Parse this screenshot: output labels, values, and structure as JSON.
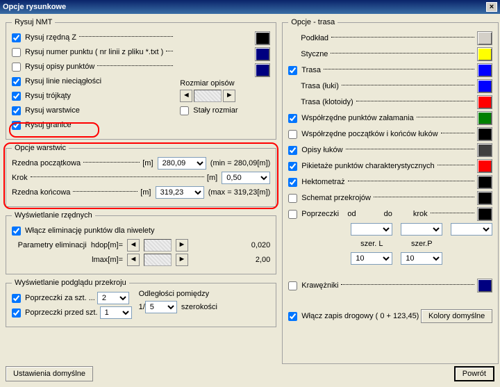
{
  "title": "Opcje rysunkowe",
  "nmt": {
    "legend": "Rysuj NMT",
    "rzedna_z": {
      "label": "Rysuj rzędną Z",
      "checked": true,
      "color": "#000000"
    },
    "numer_pkt": {
      "label": "Rysuj numer punktu ( nr linii z pliku *.txt )",
      "checked": false,
      "color": "#000080"
    },
    "opisy_pkt": {
      "label": "Rysuj opisy punktów",
      "checked": false,
      "color": "#000080"
    },
    "linie_nieciag": {
      "label": "Rysuj linie nieciągłości",
      "checked": true
    },
    "trojkaty": {
      "label": "Rysuj trójkąty",
      "checked": true
    },
    "warstwice": {
      "label": "Rysuj warstwice",
      "checked": true
    },
    "granice": {
      "label": "Rysuj granice",
      "checked": true
    },
    "rozmiar_opisow": "Rozmiar opisów",
    "staly_rozmiar": {
      "label": "Stały rozmiar",
      "checked": false
    }
  },
  "warstwice": {
    "legend": "Opcje warstwic",
    "rzedna_pocz": {
      "label": "Rzedna początkowa",
      "unit": "[m]",
      "value": "280,09",
      "hint": "(min = 280,09[m])"
    },
    "krok": {
      "label": "Krok",
      "unit": "[m]",
      "value": "0,50"
    },
    "rzedna_konc": {
      "label": "Rzedna końcowa",
      "unit": "[m]",
      "value": "319,23",
      "hint": "(max = 319,23[m])"
    }
  },
  "rzednych": {
    "legend": "Wyświetlanie rzędnych",
    "wlacz": {
      "label": "Włącz eliminację punktów dla niwelety",
      "checked": true
    },
    "params_label": "Parametry eliminacji",
    "hdop": {
      "label": "hdop[m]=",
      "value": "0,020"
    },
    "lmax": {
      "label": "lmax[m]=",
      "value": "2,00"
    }
  },
  "przekroj": {
    "legend": "Wyświetlanie podglądu przekroju",
    "za": {
      "label": "Poprzeczki za szt.",
      "value": "2",
      "checked": true
    },
    "przed": {
      "label": "Poprzeczki przed szt.",
      "value": "1",
      "checked": true
    },
    "odl": "Odległości pomiędzy",
    "frac_prefix": "1/",
    "frac_value": "5",
    "frac_suffix": "szerokości"
  },
  "trasa": {
    "legend": "Opcje - trasa",
    "podklad": {
      "label": "Podkład",
      "checked": false,
      "color": "#D4D0C8"
    },
    "styczne": {
      "label": "Styczne",
      "checked": false,
      "color": "#FFFF00"
    },
    "trasa": {
      "label": "Trasa",
      "checked": true,
      "color": "#0000FF"
    },
    "luki": {
      "label": "Trasa (łuki)",
      "color": "#0000FF"
    },
    "klotoidy": {
      "label": "Trasa (klotoidy)",
      "color": "#FF0000"
    },
    "wsp_zalam": {
      "label": "Współrzędne punktów załamania",
      "checked": true,
      "color": "#008000"
    },
    "wsp_lukow": {
      "label": "Współrzędne początków i końców łuków",
      "checked": false,
      "color": "#000000"
    },
    "opisy_lukow": {
      "label": "Opisy łuków",
      "checked": true,
      "color": "#404040"
    },
    "pikietaze": {
      "label": "Pikietaże punktów charakterystycznych",
      "checked": true,
      "color": "#FF0000"
    },
    "hektometraz": {
      "label": "Hektometraż",
      "checked": true,
      "color": "#000000"
    },
    "schemat": {
      "label": "Schemat przekrojów",
      "checked": false,
      "color": "#000000"
    },
    "poprzeczki": {
      "label": "Poprzeczki",
      "checked": false,
      "od": "od",
      "do": "do",
      "krok": "krok",
      "color": "#000000"
    },
    "szerL": {
      "label": "szer. L",
      "value": "10"
    },
    "szerP": {
      "label": "szer.P",
      "value": "10"
    },
    "kraweznik": {
      "label": "Krawężniki",
      "checked": false,
      "color": "#000080"
    },
    "zapis": {
      "label": "Włącz zapis drogowy ( 0 + 123,45)",
      "checked": true
    },
    "kolory_btn": "Kolory domyślne"
  },
  "footer": {
    "ustawienia": "Ustawienia domyślne",
    "powrot": "Powrót"
  }
}
